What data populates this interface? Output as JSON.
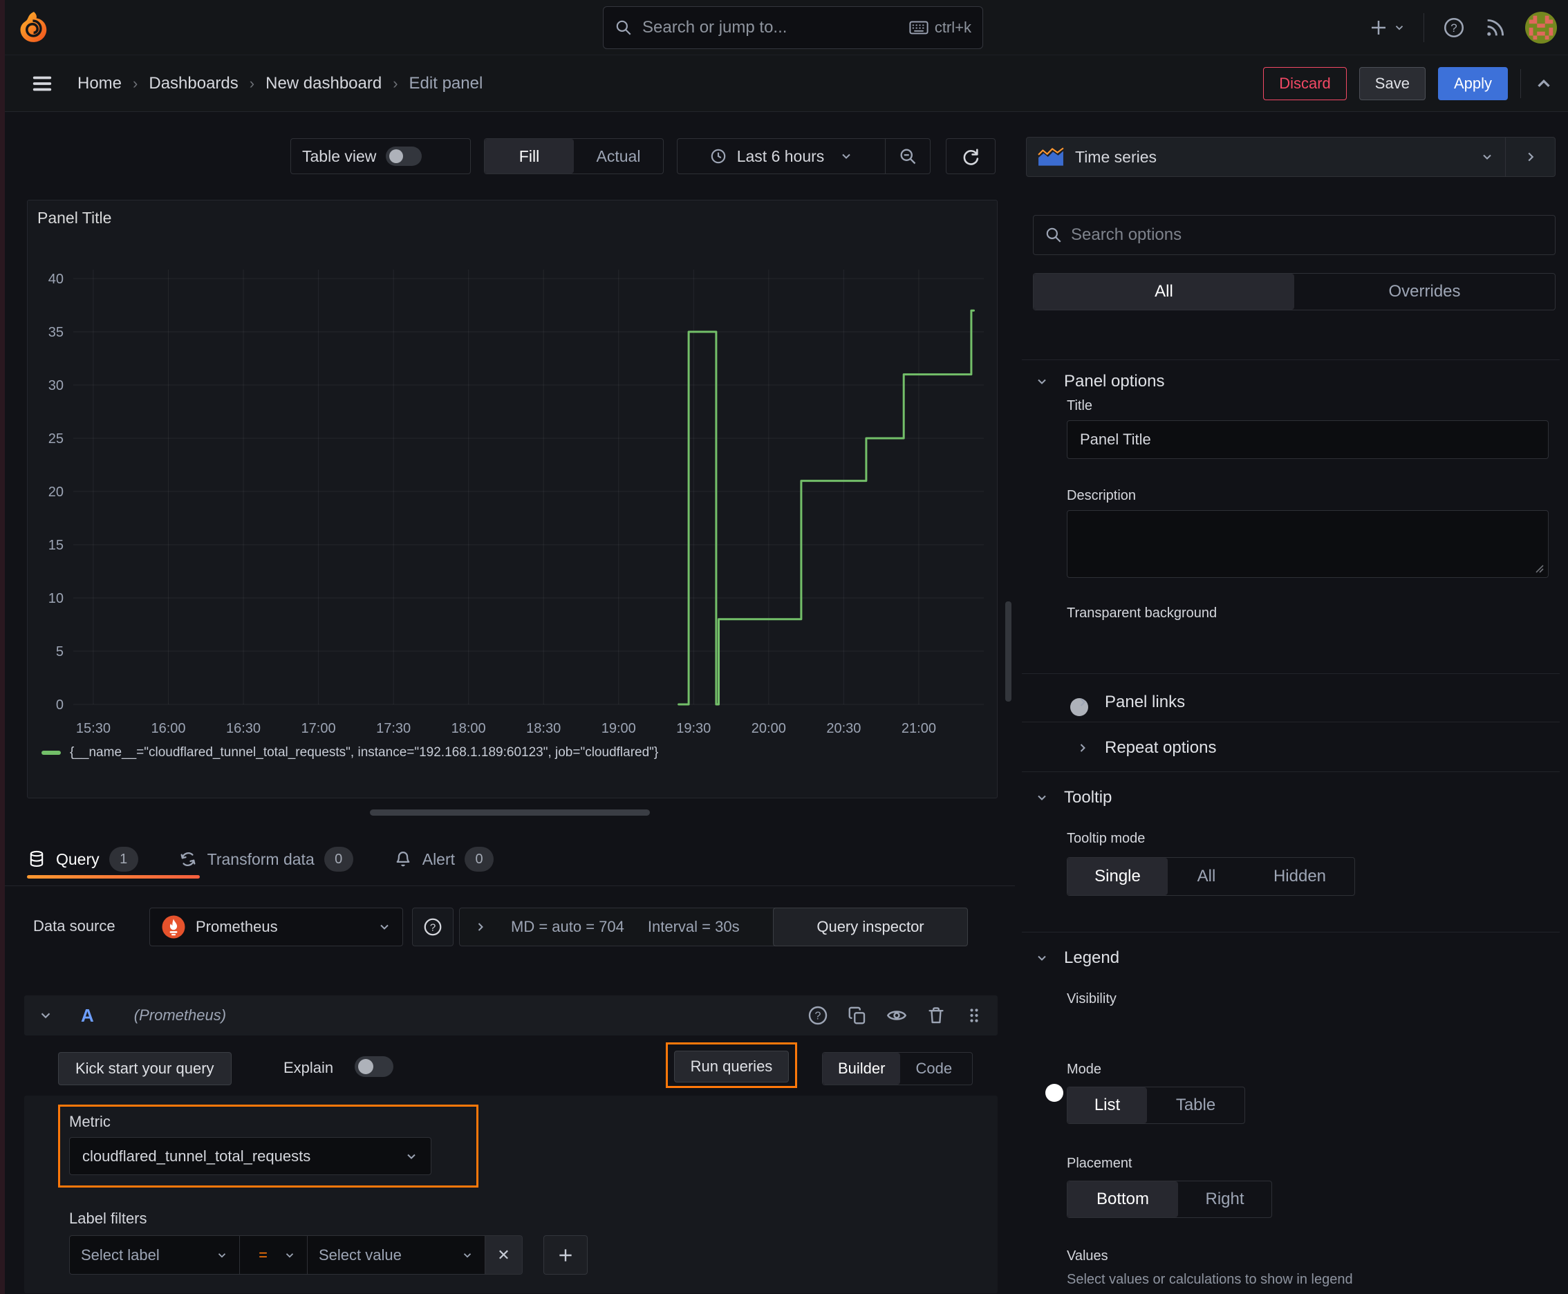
{
  "topnav": {
    "search_placeholder": "Search or jump to...",
    "search_shortcut": "ctrl+k"
  },
  "breadcrumb": {
    "items": [
      "Home",
      "Dashboards",
      "New dashboard",
      "Edit panel"
    ]
  },
  "actions": {
    "discard": "Discard",
    "save": "Save",
    "apply": "Apply"
  },
  "toolbar": {
    "table_view_label": "Table view",
    "fill": "Fill",
    "actual": "Actual",
    "time_range": "Last 6 hours"
  },
  "panel": {
    "title": "Panel Title",
    "legend_series": "{__name__=\"cloudflared_tunnel_total_requests\", instance=\"192.168.1.189:60123\", job=\"cloudflared\"}"
  },
  "chart_data": {
    "type": "line",
    "line_style": "step",
    "title": "Panel Title",
    "x_ticks": [
      "15:30",
      "16:00",
      "16:30",
      "17:00",
      "17:30",
      "18:00",
      "18:30",
      "19:00",
      "19:30",
      "20:00",
      "20:30",
      "21:00"
    ],
    "x_domain": [
      "15:22",
      "21:26"
    ],
    "ylim": [
      0,
      40
    ],
    "y_ticks": [
      0,
      5,
      10,
      15,
      20,
      25,
      30,
      35,
      40
    ],
    "grid": true,
    "legend_position": "bottom",
    "series": [
      {
        "name": "{__name__=\"cloudflared_tunnel_total_requests\", instance=\"192.168.1.189:60123\", job=\"cloudflared\"}",
        "color": "#73BF69",
        "points": [
          [
            "19:24",
            0
          ],
          [
            "19:28",
            0
          ],
          [
            "19:28",
            35
          ],
          [
            "19:39",
            35
          ],
          [
            "19:39",
            0
          ],
          [
            "19:40",
            0
          ],
          [
            "19:40",
            8
          ],
          [
            "20:13",
            8
          ],
          [
            "20:13",
            21
          ],
          [
            "20:39",
            21
          ],
          [
            "20:39",
            25
          ],
          [
            "20:54",
            25
          ],
          [
            "20:54",
            31
          ],
          [
            "21:21",
            31
          ],
          [
            "21:21",
            37
          ],
          [
            "21:22",
            37
          ]
        ]
      }
    ]
  },
  "tabs": {
    "query": {
      "label": "Query",
      "count": "1"
    },
    "transform": {
      "label": "Transform data",
      "count": "0"
    },
    "alert": {
      "label": "Alert",
      "count": "0"
    }
  },
  "datasource": {
    "label": "Data source",
    "name": "Prometheus",
    "md": "MD = auto = 704",
    "interval": "Interval = 30s",
    "query_inspector": "Query inspector"
  },
  "query_editor": {
    "ref_id": "A",
    "ds_hint": "(Prometheus)",
    "kick_start": "Kick start your query",
    "explain": "Explain",
    "run_queries": "Run queries",
    "builder": "Builder",
    "code": "Code",
    "metric_label": "Metric",
    "metric_value": "cloudflared_tunnel_total_requests",
    "label_filters": "Label filters",
    "select_label": "Select label",
    "equals": "=",
    "select_value": "Select value"
  },
  "sidebar": {
    "visualization": "Time series",
    "search_placeholder": "Search options",
    "tab_all": "All",
    "tab_overrides": "Overrides",
    "panel_options": {
      "title": "Panel options",
      "title_label": "Title",
      "title_value": "Panel Title",
      "description_label": "Description",
      "transparent_label": "Transparent background"
    },
    "panel_links": "Panel links",
    "repeat_options": "Repeat options",
    "tooltip": {
      "title": "Tooltip",
      "mode_label": "Tooltip mode",
      "options": [
        "Single",
        "All",
        "Hidden"
      ]
    },
    "legend": {
      "title": "Legend",
      "visibility_label": "Visibility",
      "mode_label": "Mode",
      "mode_options": [
        "List",
        "Table"
      ],
      "placement_label": "Placement",
      "placement_options": [
        "Bottom",
        "Right"
      ],
      "values_label": "Values",
      "values_desc": "Select values or calculations to show in legend"
    }
  },
  "colors": {
    "annotation_orange": "#FF780A",
    "series_green": "#73BF69",
    "primary_blue": "#3D71D9",
    "discard_red": "#F24965"
  }
}
